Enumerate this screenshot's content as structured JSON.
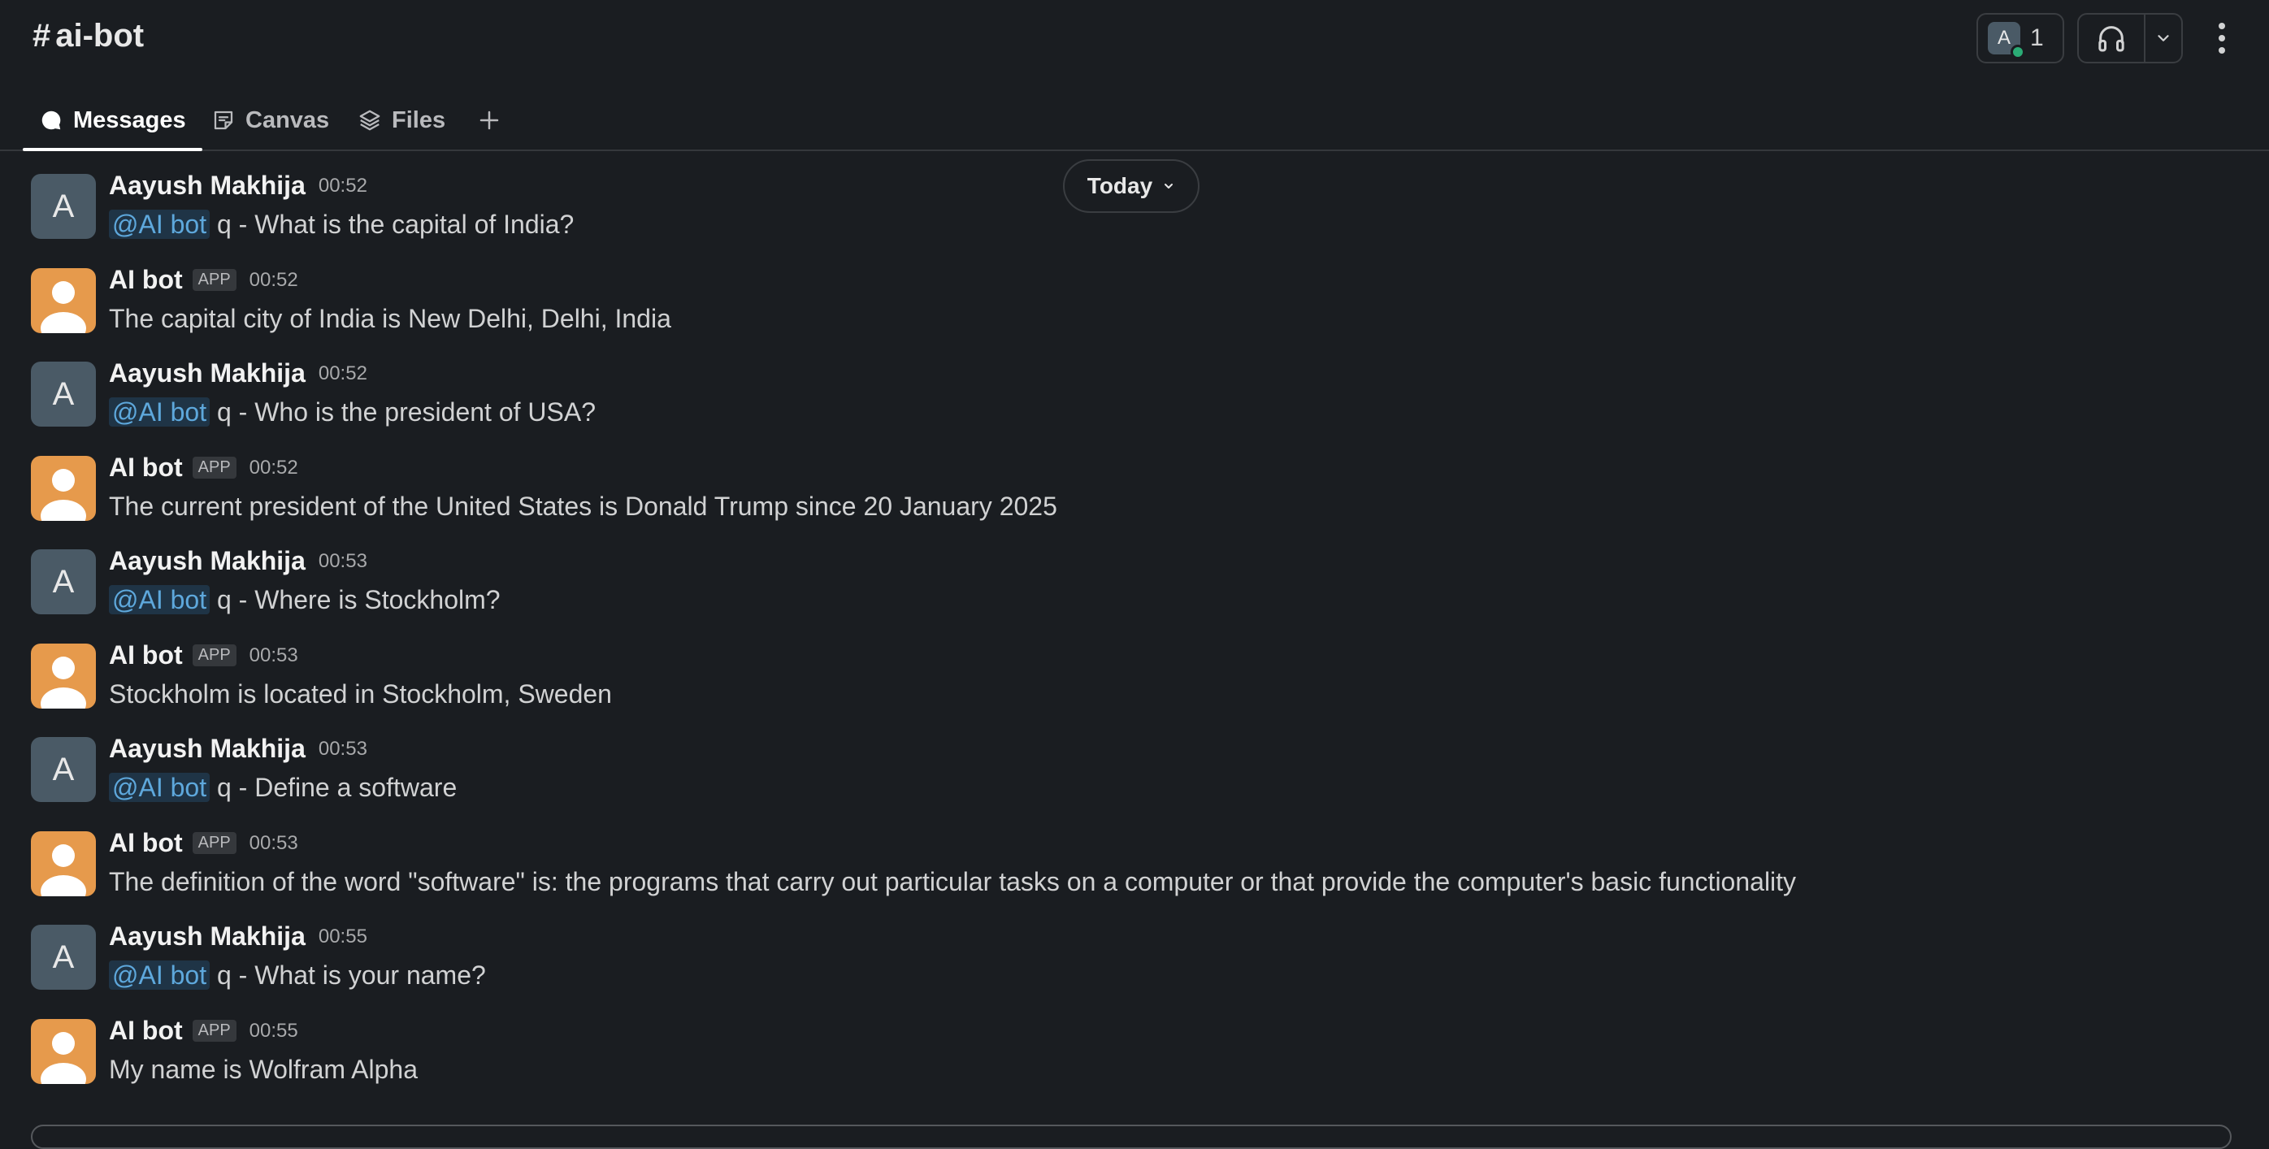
{
  "channel": {
    "hash": "#",
    "name": "ai-bot"
  },
  "header": {
    "member_avatar_letter": "A",
    "member_count": "1"
  },
  "tabs": [
    {
      "label": "Messages",
      "active": true
    },
    {
      "label": "Canvas",
      "active": false
    },
    {
      "label": "Files",
      "active": false
    }
  ],
  "date_pill": {
    "label": "Today"
  },
  "messages": [
    {
      "sender": "Aayush Makhija",
      "type": "user",
      "avatar_letter": "A",
      "time": "00:52",
      "mention": "@AI bot",
      "text": " q - What is the capital of India?"
    },
    {
      "sender": "AI bot",
      "type": "bot",
      "badge": "APP",
      "time": "00:52",
      "text": "The capital city of India is New Delhi, Delhi, India"
    },
    {
      "sender": "Aayush Makhija",
      "type": "user",
      "avatar_letter": "A",
      "time": "00:52",
      "mention": "@AI bot",
      "text": " q - Who is the president of USA?"
    },
    {
      "sender": "AI bot",
      "type": "bot",
      "badge": "APP",
      "time": "00:52",
      "text": "The current president of the United States is Donald Trump since 20 January 2025"
    },
    {
      "sender": "Aayush Makhija",
      "type": "user",
      "avatar_letter": "A",
      "time": "00:53",
      "mention": "@AI bot",
      "text": " q - Where is Stockholm?"
    },
    {
      "sender": "AI bot",
      "type": "bot",
      "badge": "APP",
      "time": "00:53",
      "text": "Stockholm is located in Stockholm, Sweden"
    },
    {
      "sender": "Aayush Makhija",
      "type": "user",
      "avatar_letter": "A",
      "time": "00:53",
      "mention": "@AI bot",
      "text": " q - Define a software"
    },
    {
      "sender": "AI bot",
      "type": "bot",
      "badge": "APP",
      "time": "00:53",
      "text": "The definition of the word \"software\" is: the programs that carry out particular tasks on a computer or that provide the computer's basic functionality"
    },
    {
      "sender": "Aayush Makhija",
      "type": "user",
      "avatar_letter": "A",
      "time": "00:55",
      "mention": "@AI bot",
      "text": " q - What is your name?"
    },
    {
      "sender": "AI bot",
      "type": "bot",
      "badge": "APP",
      "time": "00:55",
      "text": "My name is Wolfram Alpha"
    }
  ],
  "colors": {
    "background": "#1a1d21",
    "mention": "#5ea8dc",
    "bot_avatar": "#e69a4c",
    "user_avatar": "#4a5a66",
    "presence": "#2bac76"
  }
}
